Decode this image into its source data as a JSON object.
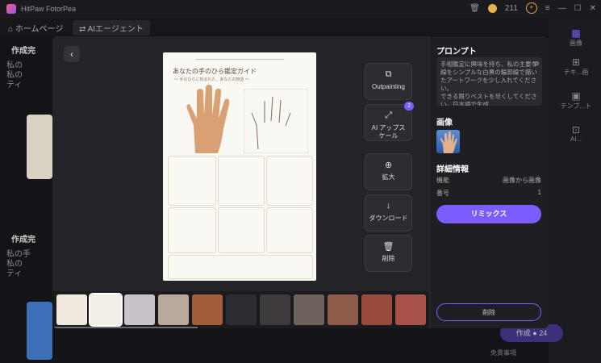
{
  "app": {
    "title": "HitPaw FotorPea",
    "credits": "211"
  },
  "nav": {
    "home": "ホームページ",
    "crumb": "AIエージェント"
  },
  "background": {
    "item1_title": "作成完",
    "item1_text": "私の\n私の\nティ",
    "item2_title": "作成完",
    "item2_text": "私の手\n私の\nティ"
  },
  "sidebar_right": {
    "label1": "画像",
    "label2": "テキ...画",
    "label3": "テンプ...ト",
    "label4": "AI..."
  },
  "tools": [
    {
      "label": "Outpainting",
      "icon": "outpaint-icon"
    },
    {
      "label": "AI アップス\nケール",
      "icon": "upscale-icon",
      "badge": "2"
    },
    {
      "label": "拡大",
      "icon": "zoom-icon"
    },
    {
      "label": "ダウンロード",
      "icon": "download-icon"
    },
    {
      "label": "削除",
      "icon": "trash-icon"
    }
  ],
  "doc": {
    "title": "あなたの手のひら鑑定ガイド",
    "subtitle": "〜 手のひらに刻まれた、あなたの物語 〜"
  },
  "info": {
    "prompt_heading": "プロンプト",
    "prompt_text": "手相鑑定に興味を持ち、私の主要な線をシンプルな白黒の輪郭線で描いたアートワークを少し入れてください。\nできる限りベストを尽くしてください。日本語で生成",
    "image_heading": "画像",
    "details_heading": "詳細情報",
    "function_label": "機能",
    "function_value": "画像から画像",
    "number_label": "番号",
    "number_value": "1",
    "remix_label": "リミックス",
    "delete_label": "削除"
  },
  "footer": {
    "create": "作成 ● 24",
    "note": "免責事項"
  }
}
